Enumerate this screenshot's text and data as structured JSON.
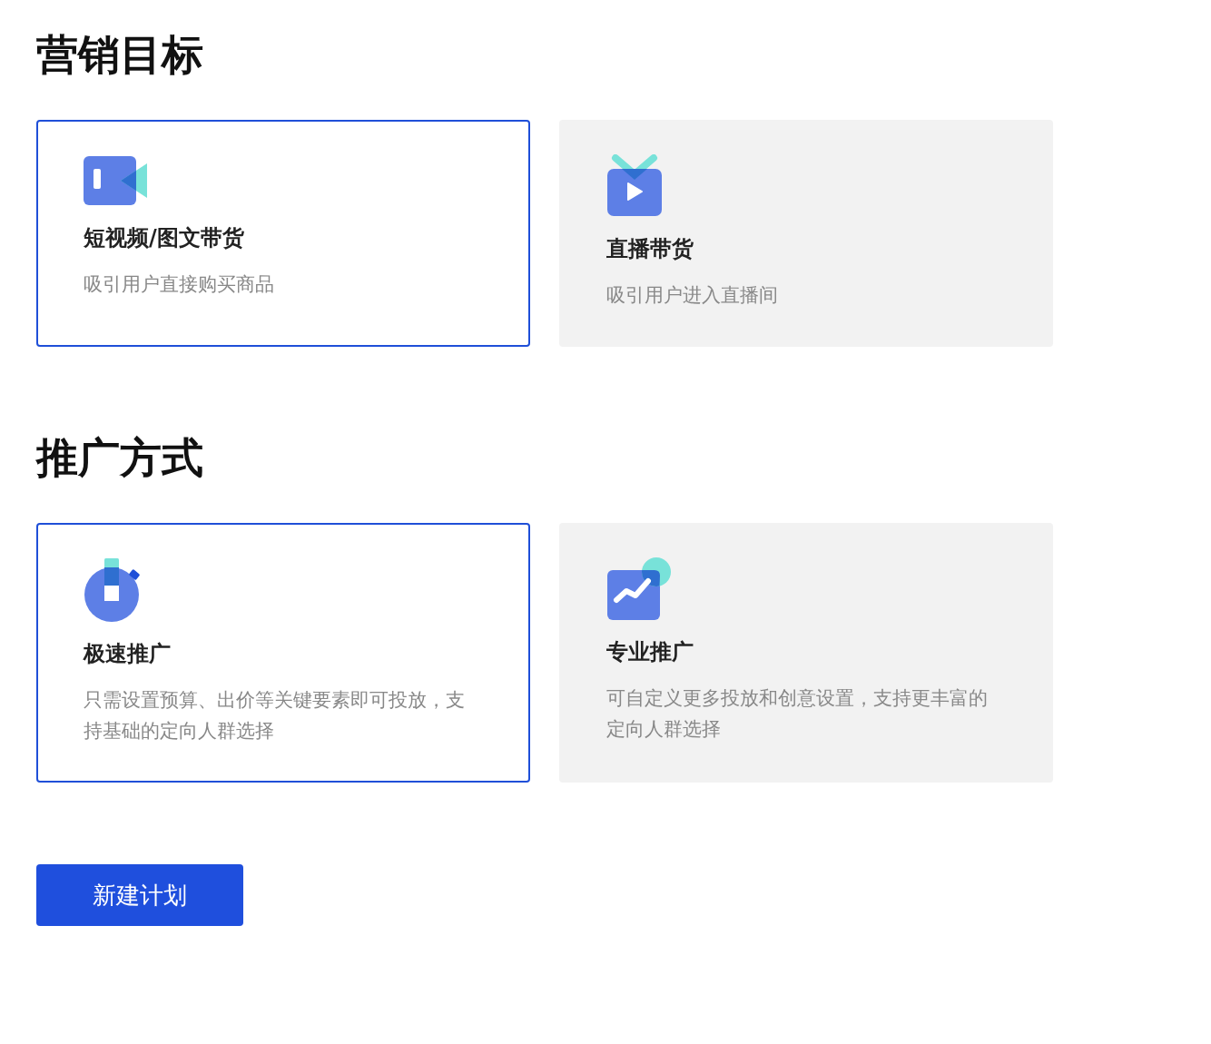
{
  "sections": [
    {
      "title": "营销目标",
      "options": [
        {
          "kind": "video",
          "title": "短视频/图文带货",
          "description": "吸引用户直接购买商品",
          "selected": true
        },
        {
          "kind": "live",
          "title": "直播带货",
          "description": "吸引用户进入直播间",
          "selected": false
        }
      ]
    },
    {
      "title": "推广方式",
      "options": [
        {
          "kind": "stopwatch",
          "title": "极速推广",
          "description": "只需设置预算、出价等关键要素即可投放，支持基础的定向人群选择",
          "selected": true
        },
        {
          "kind": "chart",
          "title": "专业推广",
          "description": "可自定义更多投放和创意设置，支持更丰富的定向人群选择",
          "selected": false
        }
      ]
    }
  ],
  "button": "新建计划"
}
